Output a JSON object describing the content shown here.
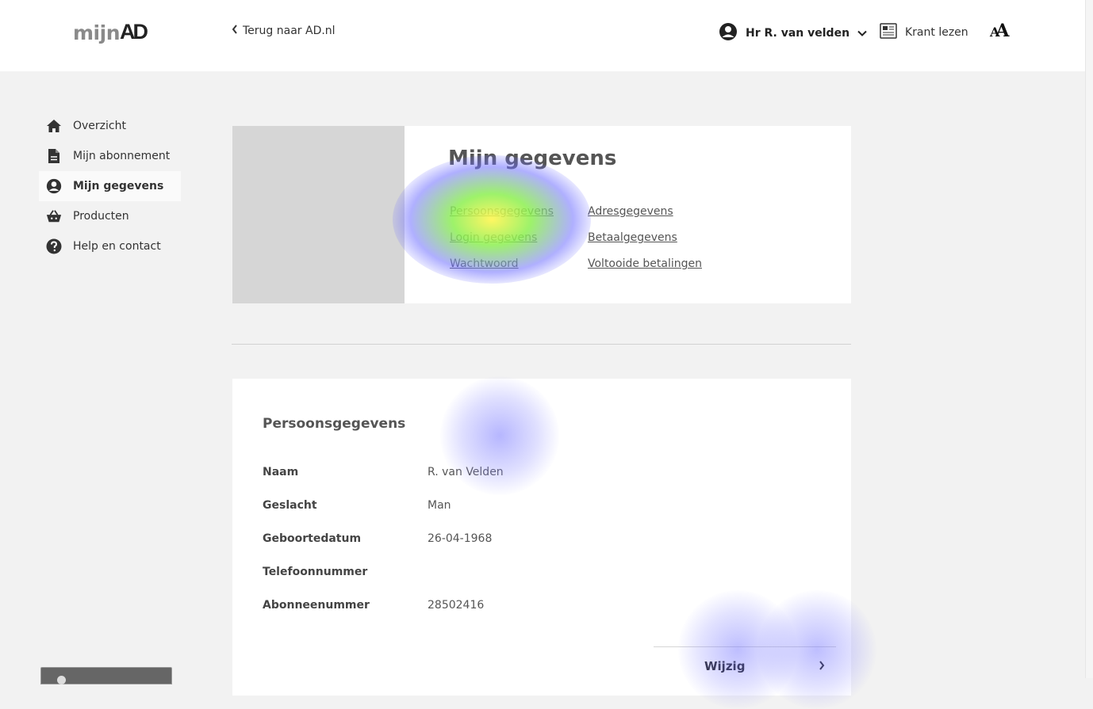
{
  "header": {
    "logo_mijn": "mijn",
    "logo_ad": "AD",
    "back_link": "Terug naar AD.nl",
    "user_name": "Hr R. van velden",
    "krant_lezen": "Krant lezen",
    "font_toggle": "A"
  },
  "sidebar": {
    "items": [
      {
        "label": "Overzicht",
        "icon": "home-icon",
        "active": false
      },
      {
        "label": "Mijn abonnement",
        "icon": "document-icon",
        "active": false
      },
      {
        "label": "Mijn gegevens",
        "icon": "user-circle-icon",
        "active": true
      },
      {
        "label": "Producten",
        "icon": "basket-icon",
        "active": false
      },
      {
        "label": "Help en contact",
        "icon": "question-circle-icon",
        "active": false
      }
    ]
  },
  "overview_card": {
    "title": "Mijn gegevens",
    "links": [
      "Persoonsgegevens",
      "Adresgegevens",
      "Login gegevens",
      "Betaalgegevens",
      "Wachtwoord",
      "Voltooide betalingen"
    ]
  },
  "details": {
    "title": "Persoonsgegevens",
    "rows": [
      {
        "label": "Naam",
        "value": "R. van Velden"
      },
      {
        "label": "Geslacht",
        "value": "Man"
      },
      {
        "label": "Geboortedatum",
        "value": "26-04-1968"
      },
      {
        "label": "Telefoonnummer",
        "value": ""
      },
      {
        "label": "Abonneenummer",
        "value": "28502416"
      }
    ],
    "edit_label": "Wijzig"
  },
  "colors": {
    "page_bg": "#f2f2f2",
    "card_bg": "#ffffff",
    "placeholder": "#d6d6d6",
    "text": "#333333"
  }
}
